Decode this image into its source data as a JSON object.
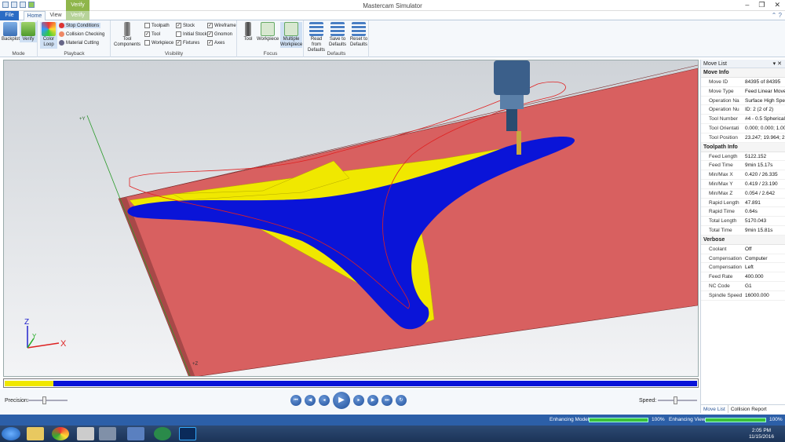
{
  "window": {
    "title": "Mastercam Simulator",
    "context_tab": "Verify"
  },
  "tabs": [
    "File",
    "Home",
    "View",
    "Verify"
  ],
  "ribbon": {
    "mode": {
      "label": "Mode",
      "backplot": "Backplot",
      "verify": "Verify"
    },
    "playback": {
      "label": "Playback",
      "color_loop": "Color Loop",
      "stop_conditions": "Stop Conditions",
      "collision_checking": "Collision Checking",
      "material_cutting": "Material Cutting"
    },
    "visibility": {
      "label": "Visibility",
      "tool_components": "Tool Components",
      "checks": [
        {
          "label": "Toolpath",
          "checked": false
        },
        {
          "label": "Tool",
          "checked": true
        },
        {
          "label": "Workpiece",
          "checked": false
        },
        {
          "label": "Stock",
          "checked": true
        },
        {
          "label": "Initial Stock",
          "checked": false
        },
        {
          "label": "Fixtures",
          "checked": true
        },
        {
          "label": "Wireframe",
          "checked": true
        },
        {
          "label": "Gnomon",
          "checked": true
        },
        {
          "label": "Axes",
          "checked": true
        }
      ]
    },
    "focus": {
      "label": "Focus",
      "tool": "Tool",
      "workpiece": "Workpiece",
      "multiple_workpiece": "Multiple Workpiece"
    },
    "defaults": {
      "label": "Defaults",
      "read": "Read from Defaults",
      "save": "Save to Defaults",
      "reset": "Reset to Defaults"
    }
  },
  "viewport": {
    "axis_x": "X",
    "axis_y": "Y",
    "axis_z": "Z",
    "corner_z": "+Z",
    "corner_y": "+Y"
  },
  "panel": {
    "title": "Move List",
    "sections": [
      {
        "name": "Move Info",
        "rows": [
          [
            "Move ID",
            "84395 of 84395"
          ],
          [
            "Move Type",
            "Feed Linear Move"
          ],
          [
            "Operation Na",
            "Surface High Spe"
          ],
          [
            "Operation Nu",
            "ID: 2 (2 of 2)"
          ],
          [
            "Tool Number",
            "#4 - 0.5 Spherical"
          ],
          [
            "Tool Orientati",
            "0.000; 0.000; 1.00"
          ],
          [
            "Tool Position",
            "23.247; 19.964; 2.1"
          ]
        ]
      },
      {
        "name": "Toolpath Info",
        "rows": [
          [
            "Feed Length",
            "5122.152"
          ],
          [
            "Feed Time",
            "9min 15.17s"
          ],
          [
            "Min/Max X",
            "0.420 / 26.335"
          ],
          [
            "Min/Max Y",
            "0.419 / 23.190"
          ],
          [
            "Min/Max Z",
            "0.054 / 2.642"
          ],
          [
            "Rapid Length",
            "47.891"
          ],
          [
            "Rapid Time",
            "0.64s"
          ],
          [
            "Total Length",
            "5170.043"
          ],
          [
            "Total Time",
            "9min 15.81s"
          ]
        ]
      },
      {
        "name": "Verbose",
        "rows": [
          [
            "Coolant",
            "Off"
          ],
          [
            "Compensation",
            "Computer"
          ],
          [
            "Compensation",
            "Left"
          ],
          [
            "Feed Rate",
            "400.000"
          ],
          [
            "NC Code",
            "G1"
          ],
          [
            "Spindle Speed",
            "16000.000"
          ]
        ]
      }
    ],
    "tabs": [
      "Move List",
      "Collision Report"
    ]
  },
  "controls": {
    "precision": "Precision:",
    "speed": "Speed:"
  },
  "status": {
    "model": "Enhancing Model",
    "model_pct": "100%",
    "view": "Enhancing View",
    "view_pct": "100%"
  },
  "clock": {
    "time": "2:05 PM",
    "date": "11/15/2016"
  },
  "colors": {
    "stock": "#d86060",
    "toolpath": "#0a14d8",
    "wall": "#f0e800",
    "accent": "#2b6cc4"
  }
}
